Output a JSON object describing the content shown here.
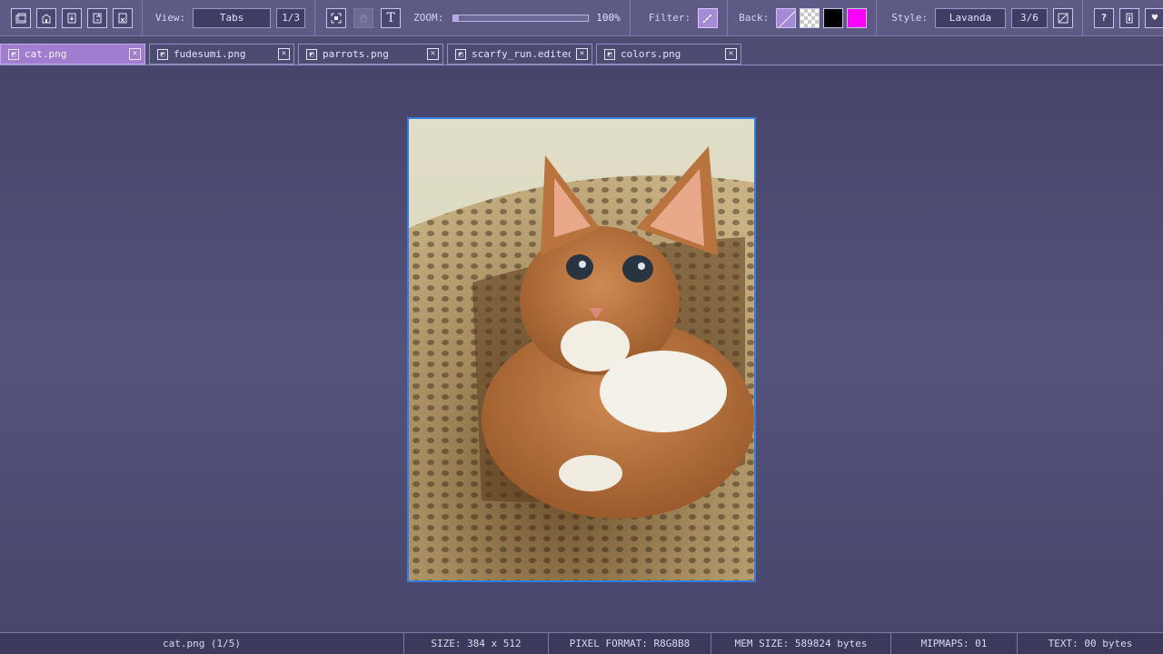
{
  "toolbar": {
    "file_icons": [
      "folder-icon",
      "home-icon",
      "import-icon",
      "export-icon",
      "close-file-icon"
    ],
    "view_label": "View:",
    "view_value": "Tabs",
    "view_counter": "1/3",
    "zoom_label": "ZOOM:",
    "zoom_value": "100%",
    "zoom_fraction": 0.04,
    "filter_label": "Filter:",
    "back_label": "Back:",
    "back_colors": [
      "#a48ad8",
      "checker",
      "#000000",
      "#ff00ff"
    ],
    "style_label": "Style:",
    "style_value": "Lavanda",
    "style_counter": "3/6",
    "right_icons": [
      "help-icon",
      "info-icon",
      "heart-icon",
      "user-icon"
    ],
    "text_icon_glyph": "T"
  },
  "tabs": [
    {
      "label": "cat.png",
      "active": true
    },
    {
      "label": "fudesumi.png",
      "active": false
    },
    {
      "label": "parrots.png",
      "active": false
    },
    {
      "label": "scarfy_run.edited.png",
      "active": false
    },
    {
      "label": "colors.png",
      "active": false
    }
  ],
  "status": {
    "file": "cat.png (1/5)",
    "size": "SIZE:  384 x 512",
    "pixel_format": "PIXEL FORMAT: R8G8B8",
    "mem_size": "MEM SIZE: 589824 bytes",
    "mipmaps": "MIPMAPS: 01",
    "text": "TEXT: 00 bytes"
  },
  "colors": {
    "accent": "#a07dcf",
    "selection_border": "#2f7fe6",
    "background": "#4e4c72"
  }
}
